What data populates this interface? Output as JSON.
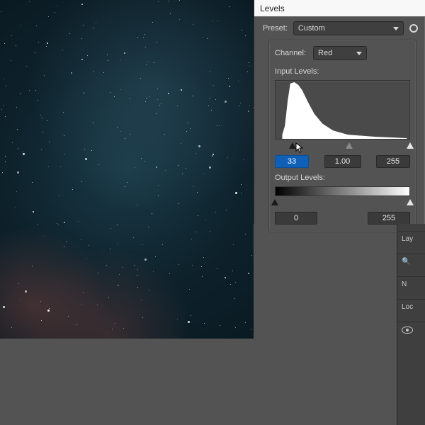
{
  "dialog": {
    "title": "Levels",
    "preset_label": "Preset:",
    "preset_value": "Custom",
    "channel_label": "Channel:",
    "channel_value": "Red",
    "input_label": "Input Levels:",
    "output_label": "Output Levels:",
    "input": {
      "black": "33",
      "gamma": "1.00",
      "white": "255",
      "black_pct": 13,
      "mid_pct": 55,
      "white_pct": 100
    },
    "output": {
      "black": "0",
      "white": "255",
      "black_pct": 0,
      "white_pct": 100
    }
  },
  "side": {
    "section": "Lay",
    "b": "N",
    "c": "Loc"
  }
}
